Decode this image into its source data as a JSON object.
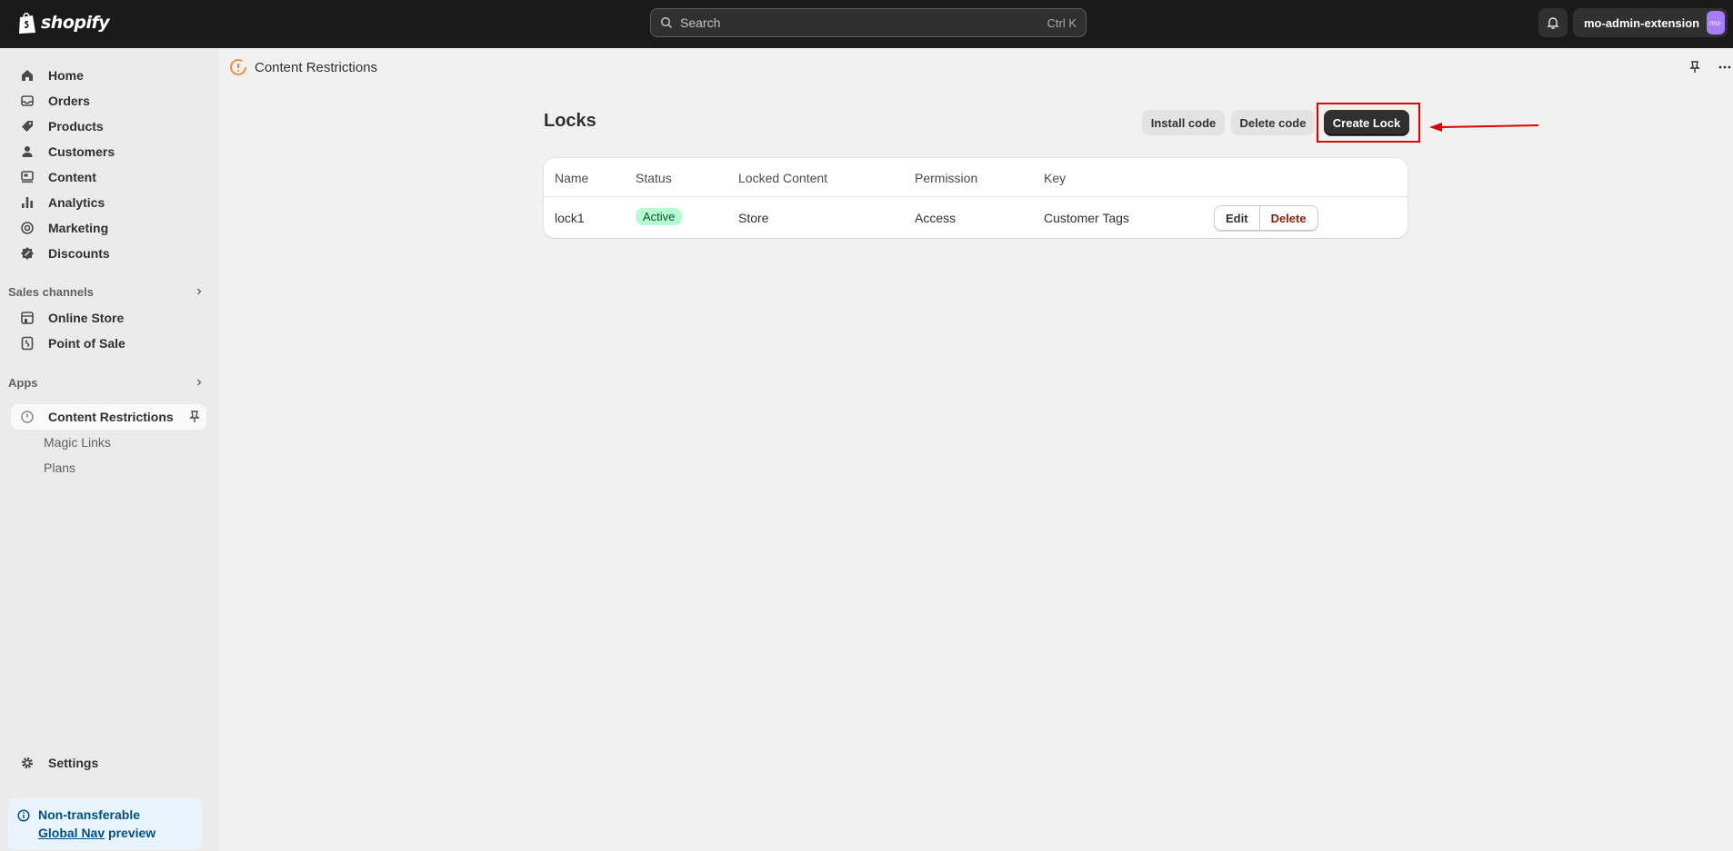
{
  "topbar": {
    "brand": "shopify",
    "search_placeholder": "Search",
    "search_shortcut": "Ctrl K",
    "account_name": "mo-admin-extension",
    "avatar_text": "mo-"
  },
  "sidebar": {
    "items": [
      {
        "label": "Home",
        "icon": "home-icon"
      },
      {
        "label": "Orders",
        "icon": "inbox-icon"
      },
      {
        "label": "Products",
        "icon": "tag-icon"
      },
      {
        "label": "Customers",
        "icon": "person-icon"
      },
      {
        "label": "Content",
        "icon": "content-icon"
      },
      {
        "label": "Analytics",
        "icon": "bar-chart-icon"
      },
      {
        "label": "Marketing",
        "icon": "target-icon"
      },
      {
        "label": "Discounts",
        "icon": "discount-icon"
      }
    ],
    "sales_channels_heading": "Sales channels",
    "sales_channels": [
      {
        "label": "Online Store",
        "icon": "store-icon"
      },
      {
        "label": "Point of Sale",
        "icon": "pos-icon"
      }
    ],
    "apps_heading": "Apps",
    "app_active": "Content Restrictions",
    "app_subitems": [
      "Magic Links",
      "Plans"
    ],
    "settings_label": "Settings",
    "notice_line1": "Non-transferable",
    "notice_link": "Global Nav",
    "notice_rest": " preview"
  },
  "main": {
    "breadcrumb": "Content Restrictions",
    "title": "Locks",
    "buttons": {
      "install": "Install code",
      "delete": "Delete code",
      "create": "Create Lock"
    },
    "table": {
      "headers": [
        "Name",
        "Status",
        "Locked Content",
        "Permission",
        "Key"
      ],
      "rows": [
        {
          "name": "lock1",
          "status": "Active",
          "locked_content": "Store",
          "permission": "Access",
          "key": "Customer Tags",
          "edit": "Edit",
          "delete": "Delete"
        }
      ]
    }
  },
  "colors": {
    "topbar": "#1a1a1a",
    "highlight": "#e00000",
    "badge_active": "#b4fed2",
    "primary_button": "#303030"
  }
}
